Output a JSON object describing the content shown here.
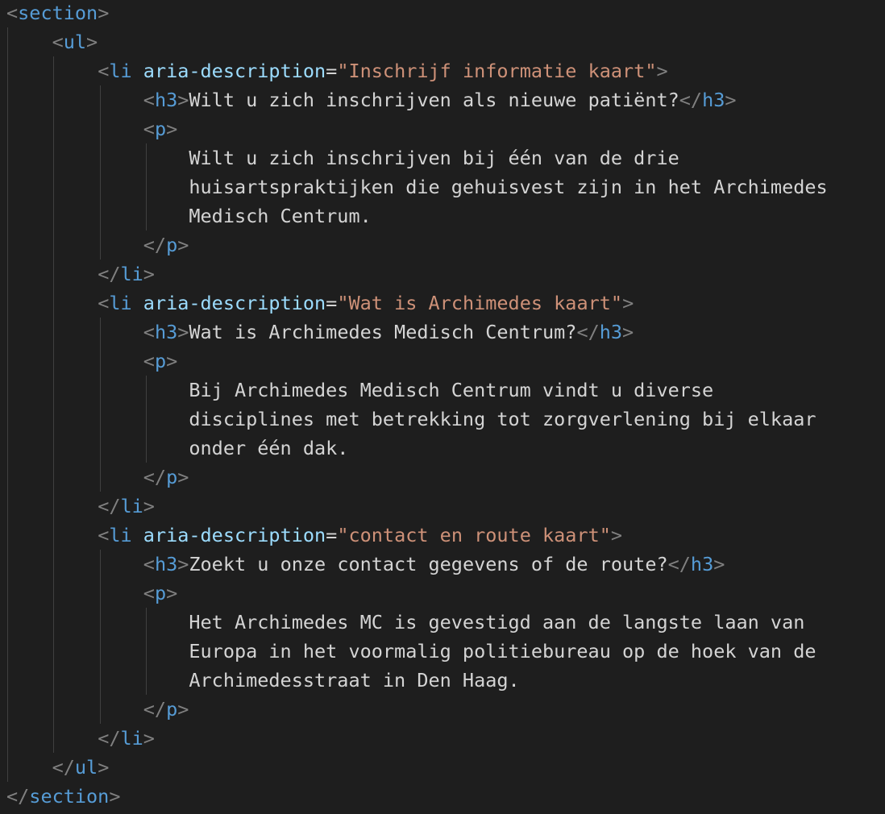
{
  "editor": {
    "colors": {
      "background": "#1e1e1e",
      "tag": "#569cd6",
      "bracket": "#808080",
      "attribute": "#9cdcfe",
      "string": "#ce9178",
      "text": "#d4d4d4",
      "indent_guide": "#404040"
    },
    "tags": {
      "section": "section",
      "ul": "ul",
      "li": "li",
      "h3": "h3",
      "p": "p"
    },
    "attr_name": "aria-description",
    "items": [
      {
        "aria": "Inschrijf informatie kaart",
        "heading": "Wilt u zich inschrijven als nieuwe patiënt?",
        "para": [
          "Wilt u zich inschrijven bij één van de drie",
          "huisartspraktijken die gehuisvest zijn in het Archimedes",
          "Medisch Centrum."
        ]
      },
      {
        "aria": "Wat is Archimedes kaart",
        "heading": "Wat is Archimedes Medisch Centrum?",
        "para": [
          "Bij Archimedes Medisch Centrum vindt u diverse",
          "disciplines met betrekking tot zorgverlening bij elkaar",
          "onder één dak."
        ]
      },
      {
        "aria": "contact en route kaart",
        "heading": "Zoekt u onze contact gegevens of de route?",
        "para": [
          "Het Archimedes MC is gevestigd aan de langste laan van",
          "Europa in het voormalig politiebureau op de hoek van de",
          "Archimedesstraat in Den Haag."
        ]
      }
    ]
  }
}
